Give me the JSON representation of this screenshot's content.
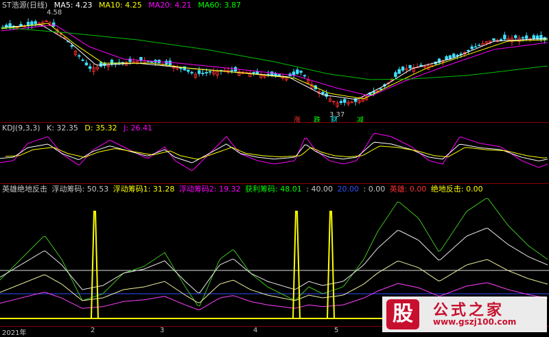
{
  "main_panel": {
    "title": "ST浩源(日线)",
    "ma": [
      {
        "label": "MA5: 4.23",
        "color": "#ffffff"
      },
      {
        "label": "MA10: 4.25",
        "color": "#ffff00"
      },
      {
        "label": "MA20: 4.21",
        "color": "#ff00ff"
      },
      {
        "label": "MA60: 3.87",
        "color": "#00ff00"
      }
    ],
    "high_label": "4.58",
    "low_label": "3.37",
    "signal_labels": [
      {
        "text": "涨",
        "color": "#ff3030"
      },
      {
        "text": "跌",
        "color": "#00ff00"
      },
      {
        "text": "财",
        "color": "#00ffff"
      },
      {
        "text": "减",
        "color": "#00ff00"
      }
    ]
  },
  "kdj_panel": {
    "items": [
      {
        "label": "KDJ(9,3,3)",
        "color": "#c8c8c8"
      },
      {
        "label": "K: 32.35",
        "color": "#c8c8c8"
      },
      {
        "label": "D: 35.32",
        "color": "#ffff00"
      },
      {
        "label": "J: 26.41",
        "color": "#ff00ff"
      }
    ]
  },
  "hero_panel": {
    "items": [
      {
        "label": "英雄绝地反击",
        "color": "#c8c8c8"
      },
      {
        "label": "浮动筹码: 50.53",
        "color": "#c8c8c8"
      },
      {
        "label": "浮动筹码1: 31.28",
        "color": "#ffff00"
      },
      {
        "label": "浮动筹码2: 19.32",
        "color": "#ff00ff"
      },
      {
        "label": "获利筹码: 48.01",
        "color": "#00ff00"
      },
      {
        "label": ": 40.00",
        "color": "#c8c8c8"
      },
      {
        "label": "20.00",
        "color": "#3050ff"
      },
      {
        "label": ": 0.00",
        "color": "#c8c8c8"
      },
      {
        "label": "英雄: 0.00",
        "color": "#ff3030"
      },
      {
        "label": "绝地反击: 0.00",
        "color": "#ffff00"
      }
    ]
  },
  "time_axis": [
    "2021年",
    "2",
    "3",
    "4",
    "5"
  ],
  "watermark": {
    "logo": "股",
    "title": "公式之家",
    "url": "www.gszj100.com"
  }
}
